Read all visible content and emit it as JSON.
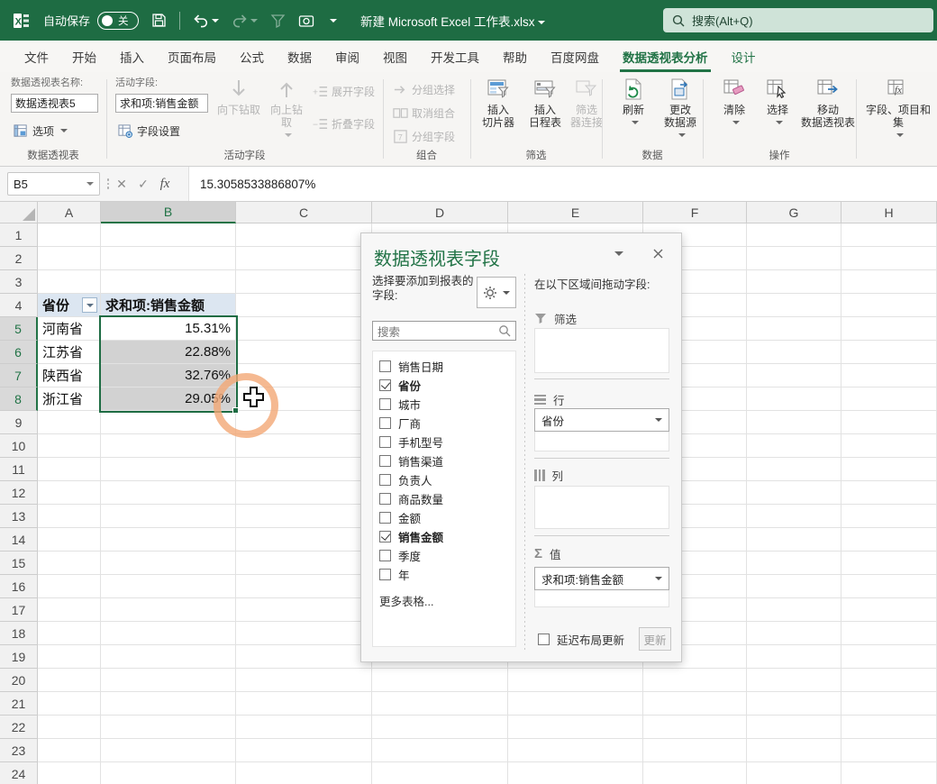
{
  "titlebar": {
    "autosave_label": "自动保存",
    "autosave_state": "关",
    "title": "新建 Microsoft Excel 工作表.xlsx",
    "search_placeholder": "搜索(Alt+Q)"
  },
  "tabs": [
    {
      "label": "文件"
    },
    {
      "label": "开始"
    },
    {
      "label": "插入"
    },
    {
      "label": "页面布局"
    },
    {
      "label": "公式"
    },
    {
      "label": "数据"
    },
    {
      "label": "审阅"
    },
    {
      "label": "视图"
    },
    {
      "label": "开发工具"
    },
    {
      "label": "帮助"
    },
    {
      "label": "百度网盘"
    },
    {
      "label": "数据透视表分析",
      "active": true
    },
    {
      "label": "设计",
      "contextual": true
    }
  ],
  "ribbon": {
    "pivot_name_label": "数据透视表名称:",
    "pivot_name_value": "数据透视表5",
    "options_label": "选项",
    "group_pivot": "数据透视表",
    "active_field_label": "活动字段:",
    "active_field_value": "求和项:销售金额",
    "field_settings": "字段设置",
    "drill_down": "向下钻取",
    "drill_up": "向上钻\n取",
    "expand_field": "展开字段",
    "collapse_field": "折叠字段",
    "group_active_field": "活动字段",
    "group_selection": "分组选择",
    "ungroup": "取消组合",
    "group_field": "分组字段",
    "group_group": "组合",
    "insert_slicer": "插入\n切片器",
    "insert_timeline": "插入\n日程表",
    "filter_connections": "筛选\n器连接",
    "group_filter": "筛选",
    "refresh": "刷新",
    "change_source": "更改\n数据源",
    "group_data": "数据",
    "clear": "清除",
    "select": "选择",
    "move_pivot": "移动\n数据透视表",
    "group_actions": "操作",
    "fields_items_sets": "字段、项目和\n集"
  },
  "formula_bar": {
    "cell_ref": "B5",
    "formula": "15.3058533886807%"
  },
  "sheet": {
    "columns": [
      "A",
      "B",
      "C",
      "D",
      "E",
      "F",
      "G",
      "H"
    ],
    "selected_column": "B",
    "row_count": 24,
    "selected_rows": [
      5,
      6,
      7,
      8
    ],
    "pivot_table": {
      "header": [
        "省份",
        "求和项:销售金额"
      ],
      "rows": [
        [
          "河南省",
          "15.31%"
        ],
        [
          "江苏省",
          "22.88%"
        ],
        [
          "陕西省",
          "32.76%"
        ],
        [
          "浙江省",
          "29.05%"
        ]
      ]
    }
  },
  "panel": {
    "title": "数据透视表字段",
    "choose_fields_label": "选择要添加到报表的字段:",
    "search_placeholder": "搜索",
    "fields": [
      {
        "label": "销售日期",
        "checked": false
      },
      {
        "label": "省份",
        "checked": true
      },
      {
        "label": "城市",
        "checked": false
      },
      {
        "label": "厂商",
        "checked": false
      },
      {
        "label": "手机型号",
        "checked": false
      },
      {
        "label": "销售渠道",
        "checked": false
      },
      {
        "label": "负责人",
        "checked": false
      },
      {
        "label": "商品数量",
        "checked": false
      },
      {
        "label": "金额",
        "checked": false
      },
      {
        "label": "销售金额",
        "checked": true
      },
      {
        "label": "季度",
        "checked": false
      },
      {
        "label": "年",
        "checked": false
      }
    ],
    "more_tables": "更多表格...",
    "drag_label": "在以下区域间拖动字段:",
    "areas": {
      "filters_label": "筛选",
      "rows_label": "行",
      "rows_field": "省份",
      "columns_label": "列",
      "values_label": "值",
      "values_field": "求和项:销售金额"
    },
    "defer_label": "延迟布局更新",
    "update_button": "更新"
  },
  "colors": {
    "titlebar_green": "#1e6c43",
    "accent_green": "#217346",
    "selection_gray": "#d2d2d2",
    "pivot_header_blue": "#dce6f1",
    "cursor_ring_orange": "#f3a776"
  }
}
